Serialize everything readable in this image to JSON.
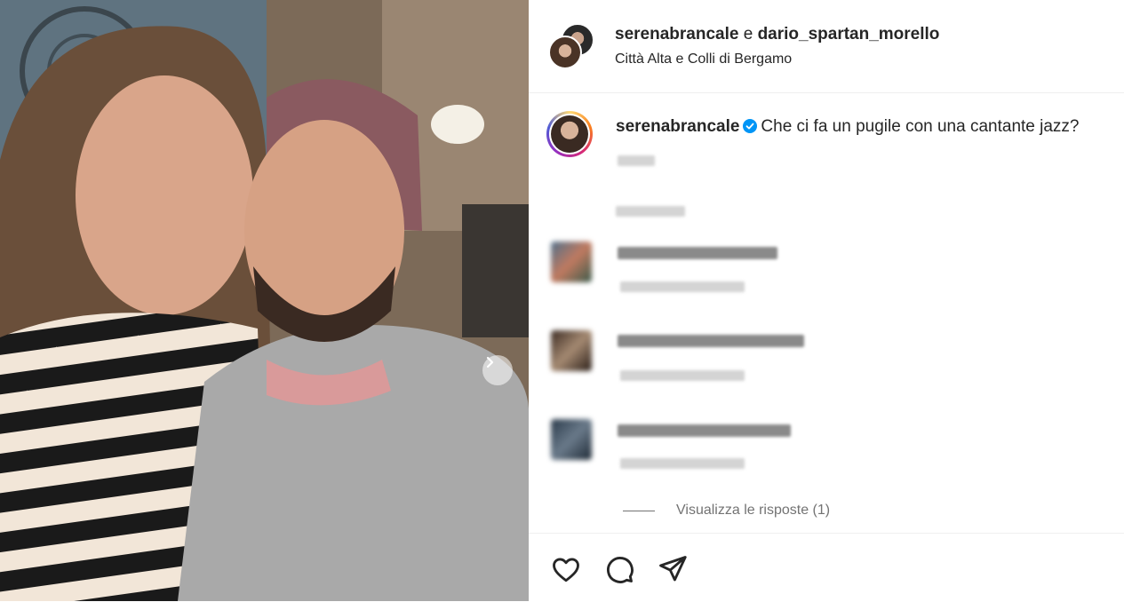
{
  "post": {
    "header": {
      "author1": "serenabrancale",
      "connector": "e",
      "author2": "dario_spartan_morello",
      "location": "Città Alta e Colli di Bergamo"
    },
    "caption": {
      "username": "serenabrancale",
      "text": "Che ci fa un pugile con una cantante jazz?"
    },
    "view_replies_label": "Visualizza le risposte (1)"
  },
  "colors": {
    "verified": "#0095f6",
    "text": "#262626",
    "secondary": "#737373"
  },
  "icons": [
    "next-arrow-icon",
    "verified-icon",
    "heart-icon",
    "comment-icon",
    "share-icon"
  ]
}
